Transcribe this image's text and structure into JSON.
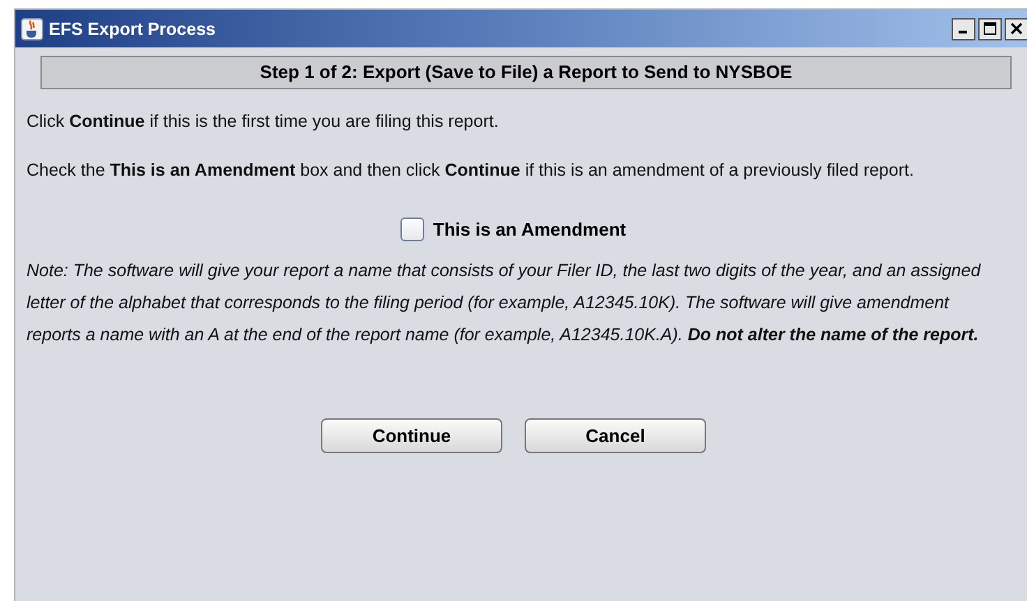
{
  "window": {
    "title": "EFS Export Process"
  },
  "heading": "Step 1 of 2:  Export (Save to File) a Report to Send to NYSBOE",
  "paragraphs": [
    "Click **Continue** if this is the first time you are filing this report.",
    "Check the **This is an Amendment** box and then click **Continue** if this is an amendment of a previously filed report."
  ],
  "amendment_checkbox": {
    "label": "This is an Amendment",
    "checked": false
  },
  "note": "Note: The software will give your report a name that consists of your Filer ID, the last two digits of the year, and an assigned letter of the alphabet that corresponds to the filing period (for example, A12345.10K). The software will give amendment reports a name with an A at the end of the report name (for example, A12345.10K.A). **Do not alter the name of the report.**",
  "buttons": [
    "Continue",
    "Cancel"
  ]
}
